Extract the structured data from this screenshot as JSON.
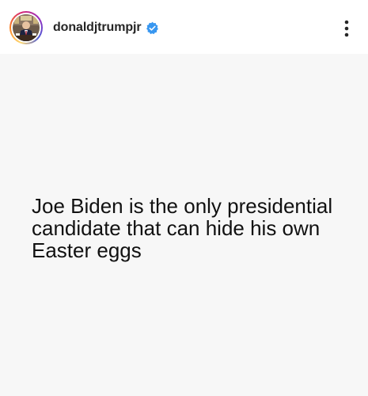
{
  "header": {
    "username": "donaldjtrumpjr",
    "verified": true,
    "avatar_icon": "profile-photo-icon",
    "more_icon": "more-options-icon"
  },
  "post": {
    "text": "Joe Biden is the only presidential candidate that can hide his own Easter eggs"
  },
  "colors": {
    "verified_blue": "#3897f0",
    "post_background": "#f7f7f7",
    "text": "#111111"
  }
}
